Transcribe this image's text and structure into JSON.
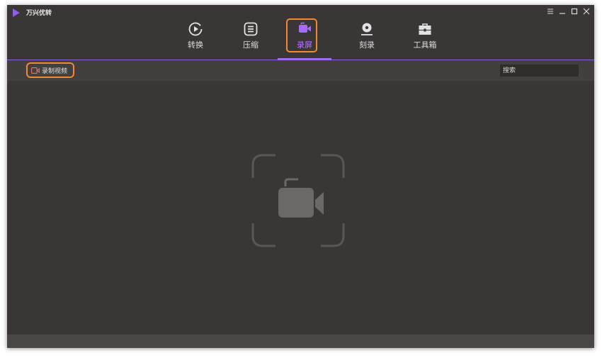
{
  "app": {
    "title": "万兴优转",
    "logo_icon": "play-triangle-icon",
    "accent_color": "#9d6cf0",
    "highlight_color": "#f08a2e"
  },
  "window_controls": [
    {
      "name": "menu-icon"
    },
    {
      "name": "minimize-icon"
    },
    {
      "name": "maximize-icon"
    },
    {
      "name": "close-icon"
    }
  ],
  "tabs": [
    {
      "label": "转换",
      "icon": "convert-icon",
      "active": false
    },
    {
      "label": "压缩",
      "icon": "compress-icon",
      "active": false
    },
    {
      "label": "录屏",
      "icon": "screen-record-icon",
      "active": true
    },
    {
      "label": "刻录",
      "icon": "burn-disc-icon",
      "active": false
    },
    {
      "label": "工具箱",
      "icon": "toolbox-icon",
      "active": false
    }
  ],
  "toolbar": {
    "record_label": "录制视频",
    "record_icon": "video-camera-icon",
    "search_placeholder": "搜索"
  },
  "main": {
    "empty_icon": "screen-record-placeholder-icon"
  }
}
